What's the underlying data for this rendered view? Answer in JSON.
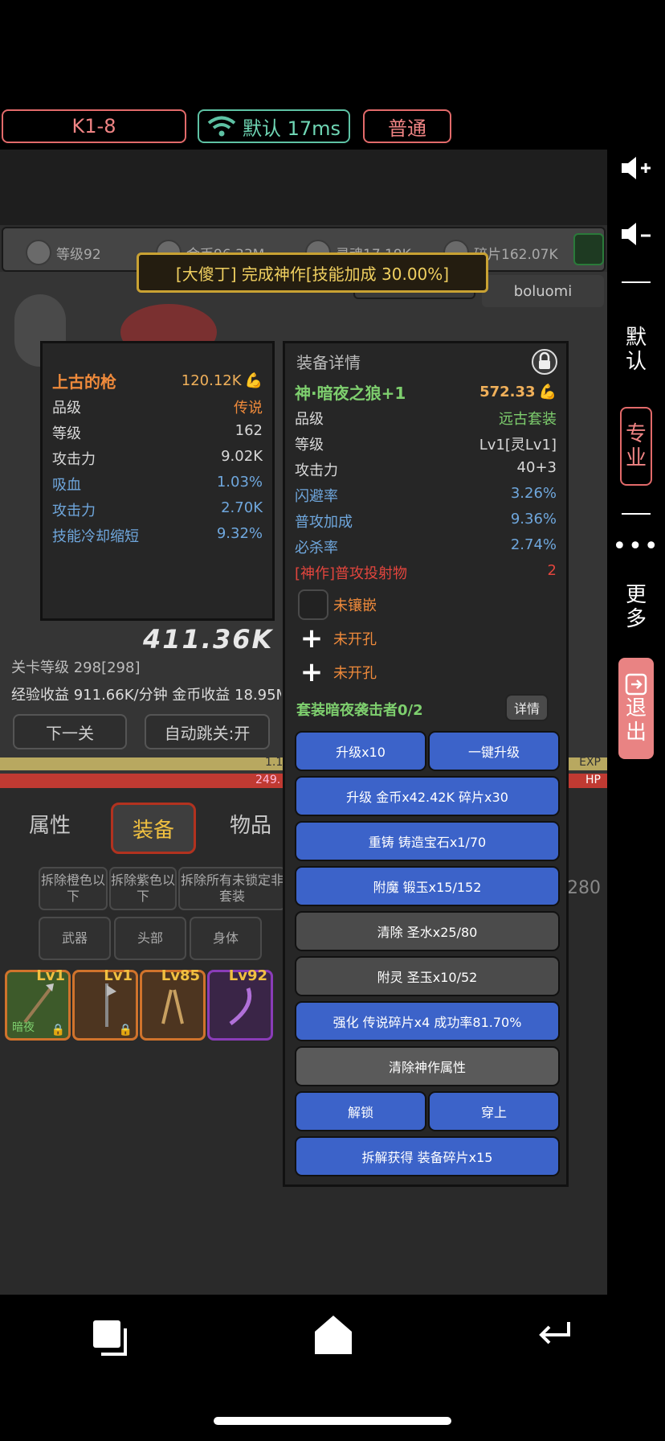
{
  "top_bar": {
    "stage": "K1-8",
    "network": "默认 17ms",
    "difficulty": "普通"
  },
  "side_toolbar": {
    "volume_up": "volume-up",
    "volume_down": "volume-down",
    "default": "默认",
    "pro": "专业",
    "more": "更多",
    "exit": "退出"
  },
  "resources": {
    "level": "等级92",
    "gold": "金币96.33M",
    "soul": "灵魂17.19K",
    "shards": "碎片162.07K"
  },
  "banner": "[大傻丁] 完成神作[技能加成 30.00%]",
  "boluomi": "boluomi",
  "left_panel": {
    "name": "上古的枪",
    "power": "120.12K",
    "rows": [
      {
        "label": "品级",
        "value": "传说",
        "color": "orange"
      },
      {
        "label": "等级",
        "value": "162",
        "color": "white"
      },
      {
        "label": "攻击力",
        "value": "9.02K",
        "color": "white"
      },
      {
        "label": "吸血",
        "value": "1.03%",
        "color": "blue"
      },
      {
        "label": "攻击力",
        "value": "2.70K",
        "color": "blue"
      },
      {
        "label": "技能冷却缩短",
        "value": "9.32%",
        "color": "blue"
      }
    ]
  },
  "right_panel": {
    "header": "装备详情",
    "name": "神·暗夜之狼+1",
    "power": "572.33",
    "rows": [
      {
        "label": "品级",
        "value": "远古套装",
        "color": "green"
      },
      {
        "label": "等级",
        "value": "Lv1[灵Lv1]",
        "color": "white"
      },
      {
        "label": "攻击力",
        "value": "40+3",
        "color": "white"
      },
      {
        "label": "闪避率",
        "value": "3.26%",
        "color": "blue"
      },
      {
        "label": "普攻加成",
        "value": "9.36%",
        "color": "blue"
      },
      {
        "label": "必杀率",
        "value": "2.74%",
        "color": "blue"
      },
      {
        "label": "[神作]普攻投射物",
        "value": "2",
        "color": "red"
      }
    ],
    "gem_slot": "未镶嵌",
    "hole_1": "未开孔",
    "hole_2": "未开孔",
    "set_bonus": "套装暗夜袭击者0/2",
    "detail_button": "详情",
    "buttons": {
      "upgrade10": "升级x10",
      "one_key": "一键升级",
      "upgrade": "升级 金币x42.42K 碎片x30",
      "recast": "重铸 铸造宝石x1/70",
      "enchant": "附魔 锻玉x15/152",
      "clear": "清除 圣水x25/80",
      "spirit": "附灵 圣玉x10/52",
      "enhance": "强化 传说碎片x4 成功率81.70%",
      "clear_masterwork": "清除神作属性",
      "unlock": "解锁",
      "equip": "穿上",
      "dismantle": "拆解获得 装备碎片x15"
    }
  },
  "game_ui": {
    "damage": "411.36K",
    "stage_level": "关卡等级 298[298]",
    "income": "经验收益 911.66K/分钟 金币收益 18.95M",
    "next_stage": "下一关",
    "auto_jump": "自动跳关:开",
    "exp_tag": "EXP",
    "hp_tag": "HP",
    "exp_val": "1.1",
    "hp_val": "249.",
    "count_280": "280",
    "tabs": [
      "属性",
      "装备",
      "物品"
    ],
    "filters_row1": [
      "拆除橙色以下",
      "拆除紫色以下",
      "拆除所有未锁定非套装"
    ],
    "filters_row2": [
      "武器",
      "头部",
      "身体"
    ],
    "items": [
      {
        "lv": "Lv1",
        "tag": "暗夜"
      },
      {
        "lv": "Lv1",
        "tag": ""
      },
      {
        "lv": "Lv85",
        "tag": ""
      },
      {
        "lv": "Lv92",
        "tag": ""
      }
    ]
  },
  "colors": {
    "accent_red": "#e26a6a",
    "accent_green": "#5ec2a4",
    "button_blue": "#3c63c9",
    "banner_gold": "#c9a233"
  }
}
